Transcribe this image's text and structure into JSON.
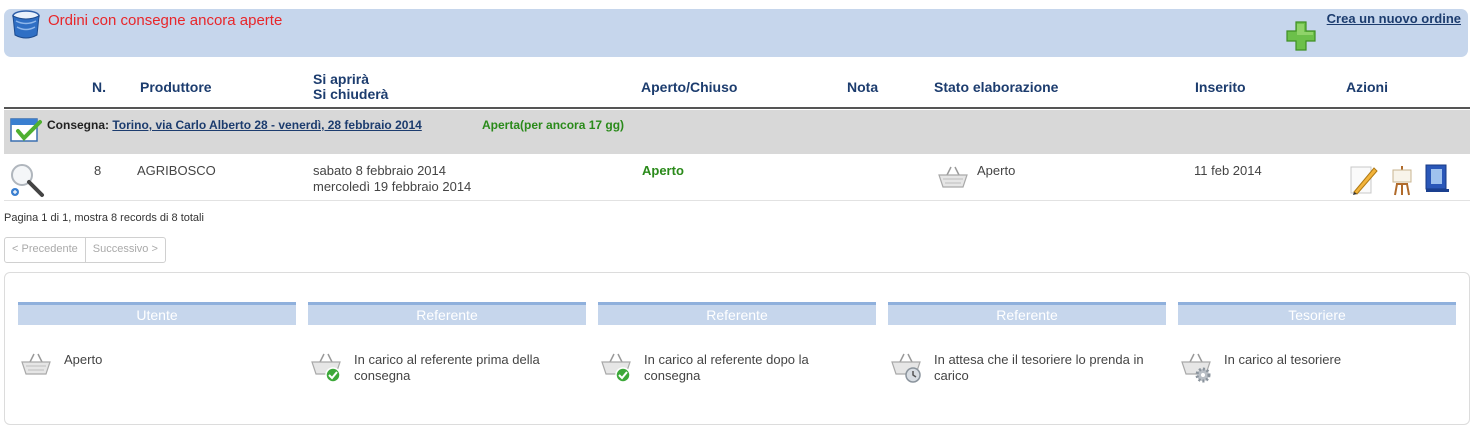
{
  "header": {
    "title": "Ordini con consegne ancora aperte",
    "new_order_label": "Crea un nuovo ordine"
  },
  "columns": {
    "n": "N.",
    "produttore": "Produttore",
    "si_aprira": "Si aprirà",
    "si_chiudera": "Si chiuderà",
    "aperto_chiuso": "Aperto/Chiuso",
    "nota": "Nota",
    "stato": "Stato elaborazione",
    "inserito": "Inserito",
    "azioni": "Azioni"
  },
  "group": {
    "prefix": "Consegna:",
    "link": "Torino, via Carlo Alberto 28 - venerdì, 28 febbraio 2014",
    "status": "Aperta(per ancora 17 gg)"
  },
  "row": {
    "n": "8",
    "produttore": "AGRIBOSCO",
    "apertura": "sabato 8 febbraio 2014",
    "chiusura": "mercoledì 19 febbraio 2014",
    "aperto_chiuso": "Aperto",
    "stato": "Aperto",
    "inserito": "11 feb 2014"
  },
  "pagination": {
    "info": "Pagina 1 di 1, mostra 8 records di 8 totali",
    "prev": "< Precedente",
    "next": "Successivo >"
  },
  "legend": [
    {
      "role": "Utente",
      "text": "Aperto",
      "icon": "basket-icon"
    },
    {
      "role": "Referente",
      "text": "In carico al referente prima della consegna",
      "icon": "basket-check-icon"
    },
    {
      "role": "Referente",
      "text": "In carico al referente dopo la consegna",
      "icon": "basket-check-icon"
    },
    {
      "role": "Referente",
      "text": "In attesa che il tesoriere lo prenda in carico",
      "icon": "basket-clock-icon"
    },
    {
      "role": "Tesoriere",
      "text": "In carico al tesoriere",
      "icon": "basket-gear-icon"
    }
  ],
  "colors": {
    "title": "#e8262a",
    "header_text": "#1c3c6e",
    "open_green": "#2a8a1a",
    "bar": "#c6d6ec"
  }
}
